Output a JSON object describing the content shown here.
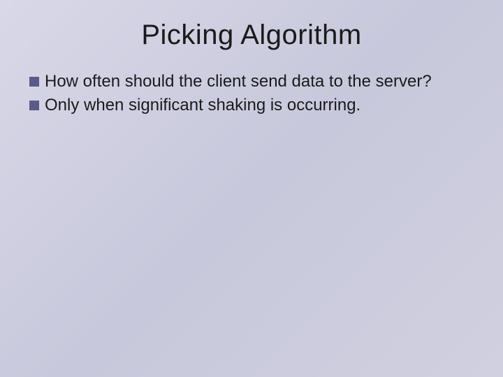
{
  "slide": {
    "title": "Picking Algorithm",
    "bullets": [
      {
        "text": "How often should the client send data to the server?"
      },
      {
        "text": "Only when significant shaking is occurring."
      }
    ]
  }
}
